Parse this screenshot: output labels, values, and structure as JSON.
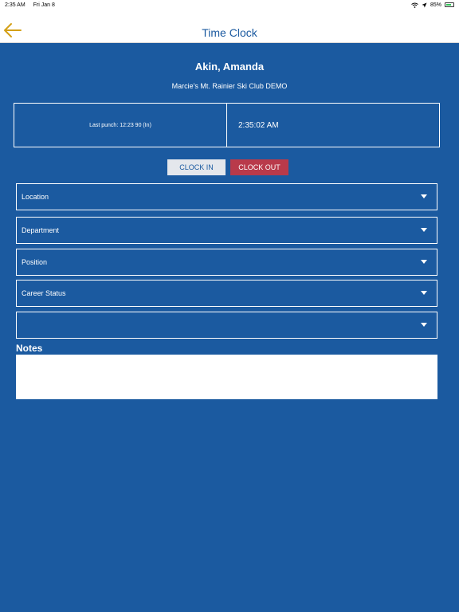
{
  "status_bar": {
    "time": "2:35 AM",
    "date": "Fri Jan 8",
    "battery": "85%"
  },
  "nav": {
    "title": "Time Clock"
  },
  "employee": {
    "name": "Akin, Amanda",
    "organization": "Marcie's Mt. Rainier Ski Club DEMO"
  },
  "punch": {
    "last_punch": "Last punch: 12:23 90 (In)",
    "current_time": "2:35:02 AM"
  },
  "buttons": {
    "clock_in": "CLOCK IN",
    "clock_out": "CLOCK OUT"
  },
  "fields": {
    "location": "Location",
    "department": "Department",
    "position": "Position",
    "career_status": "Career Status",
    "extra": ""
  },
  "notes": {
    "label": "Notes",
    "value": ""
  },
  "colors": {
    "background": "#1b5aa0",
    "clock_out": "#b93a4a",
    "back_arrow": "#d4a017"
  }
}
